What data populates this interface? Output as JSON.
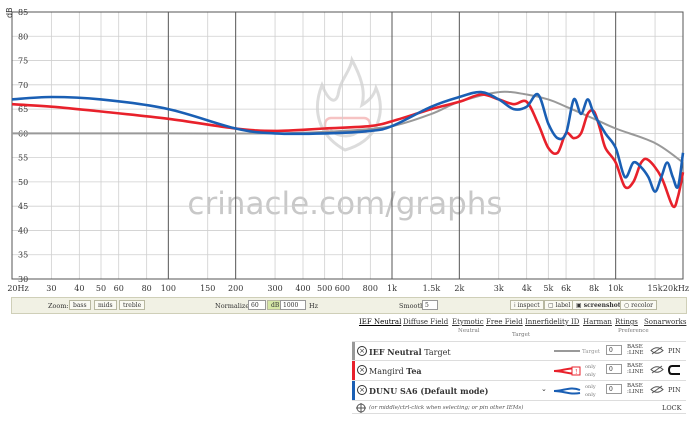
{
  "graph": {
    "unit_label": "dB",
    "watermark_text": "crinacle.com/graphs",
    "y_ticks": [
      "85",
      "80",
      "75",
      "70",
      "65",
      "60",
      "55",
      "50",
      "45",
      "40",
      "35",
      "30"
    ],
    "x_ticks": [
      "20Hz",
      "30",
      "40",
      "50",
      "60",
      "80",
      "100",
      "150",
      "200",
      "300",
      "400",
      "500",
      "600",
      "800",
      "1k",
      "1.5k",
      "2k",
      "3k",
      "4k",
      "5k",
      "6k",
      "8k",
      "10k",
      "15k",
      "20kHz"
    ],
    "colors": {
      "target": "#999999",
      "mangird": "#e8212b",
      "dunu": "#1a5fb4"
    }
  },
  "chart_data": {
    "type": "line",
    "xlabel": "",
    "ylabel": "dB",
    "x_scale": "log",
    "xlim": [
      20,
      20000
    ],
    "ylim": [
      30,
      85
    ],
    "series": [
      {
        "name": "IEF Neutral Target",
        "color": "#999999",
        "points": [
          [
            20,
            60
          ],
          [
            100,
            60
          ],
          [
            300,
            60
          ],
          [
            600,
            60.5
          ],
          [
            1000,
            61.5
          ],
          [
            1500,
            64
          ],
          [
            2000,
            66.5
          ],
          [
            3000,
            68.5
          ],
          [
            4000,
            68
          ],
          [
            5000,
            67
          ],
          [
            6000,
            65.5
          ],
          [
            8000,
            63
          ],
          [
            10000,
            61
          ],
          [
            15000,
            58
          ],
          [
            20000,
            54
          ]
        ]
      },
      {
        "name": "Mangird Tea",
        "color": "#e8212b",
        "points": [
          [
            20,
            66
          ],
          [
            30,
            65.5
          ],
          [
            50,
            64.5
          ],
          [
            100,
            63
          ],
          [
            200,
            61
          ],
          [
            300,
            60.5
          ],
          [
            500,
            61
          ],
          [
            800,
            61.5
          ],
          [
            1000,
            62.5
          ],
          [
            1500,
            65
          ],
          [
            2000,
            66.5
          ],
          [
            2500,
            68
          ],
          [
            3000,
            67
          ],
          [
            3500,
            66
          ],
          [
            4000,
            66.5
          ],
          [
            4500,
            62
          ],
          [
            5000,
            57
          ],
          [
            5500,
            56
          ],
          [
            6000,
            60
          ],
          [
            6500,
            59
          ],
          [
            7000,
            60
          ],
          [
            7500,
            64
          ],
          [
            8000,
            64.5
          ],
          [
            8500,
            61
          ],
          [
            9000,
            57
          ],
          [
            10000,
            54
          ],
          [
            11000,
            49
          ],
          [
            12000,
            50
          ],
          [
            13000,
            54
          ],
          [
            14000,
            54.5
          ],
          [
            16000,
            51
          ],
          [
            18000,
            45
          ],
          [
            19000,
            47
          ],
          [
            20000,
            52
          ]
        ]
      },
      {
        "name": "DUNU SA6 (Default mode)",
        "color": "#1a5fb4",
        "points": [
          [
            20,
            67
          ],
          [
            30,
            67.5
          ],
          [
            50,
            67
          ],
          [
            100,
            65
          ],
          [
            200,
            61
          ],
          [
            300,
            60
          ],
          [
            500,
            60
          ],
          [
            800,
            60.5
          ],
          [
            1000,
            61.5
          ],
          [
            1500,
            65.5
          ],
          [
            2000,
            67.5
          ],
          [
            2500,
            68.5
          ],
          [
            3000,
            67
          ],
          [
            3500,
            65
          ],
          [
            4000,
            65.5
          ],
          [
            4500,
            68
          ],
          [
            5000,
            62
          ],
          [
            5500,
            59
          ],
          [
            6000,
            60
          ],
          [
            6500,
            67
          ],
          [
            7000,
            64
          ],
          [
            7500,
            67
          ],
          [
            8000,
            64
          ],
          [
            9000,
            60
          ],
          [
            10000,
            57
          ],
          [
            11000,
            51
          ],
          [
            12000,
            54
          ],
          [
            13000,
            53
          ],
          [
            14000,
            51
          ],
          [
            15000,
            48
          ],
          [
            16000,
            51
          ],
          [
            17000,
            54
          ],
          [
            18000,
            51
          ],
          [
            19000,
            49
          ],
          [
            20000,
            56
          ]
        ]
      }
    ]
  },
  "toolbar": {
    "zoom_label": "Zoom:",
    "zoom_bass": "bass",
    "zoom_mids": "mids",
    "zoom_treble": "treble",
    "normalize_label": "Normalize:",
    "normalize_value": "60",
    "db_label": "dB",
    "hz_value": "1000",
    "hz_label": "Hz",
    "smooth_label": "Smooth:",
    "smooth_value": "5",
    "inspect": "inspect",
    "label": "label",
    "screenshot": "screenshot",
    "recolor": "recolor"
  },
  "panel": {
    "tabs": [
      "IEF Neutral",
      "Diffuse Field",
      "Etymotic",
      "Free Field",
      "Innerfidelity ID",
      "Harman",
      "Rtings",
      "Sonarworks"
    ],
    "tab_sub_neutral": "Neutral",
    "tab_sub_target": "Target",
    "tab_sub_preference": "Preference",
    "rows": [
      {
        "name_bold": "IEF Neutral",
        "name_rest": " Target",
        "legend": "Target",
        "offset": "0",
        "base": "BASE",
        "line": "LINE",
        "pin": "PIN",
        "color": "#999999"
      },
      {
        "name_bold": "Tea",
        "name_pre": "Mangird ",
        "legend1": "only",
        "legend2": "only",
        "offset": "0",
        "base": "BASE",
        "line": "LINE",
        "color": "#e8212b"
      },
      {
        "name_bold": "DUNU SA6 (Default mode)",
        "legend1": "only",
        "legend2": "only",
        "offset": "0",
        "base": "BASE",
        "line": "LINE",
        "pin": "PIN",
        "color": "#1a5fb4"
      }
    ],
    "add_hint": "(or middle/ctrl-click when selecting; or pin other IEMs)",
    "lock": "LOCK"
  }
}
